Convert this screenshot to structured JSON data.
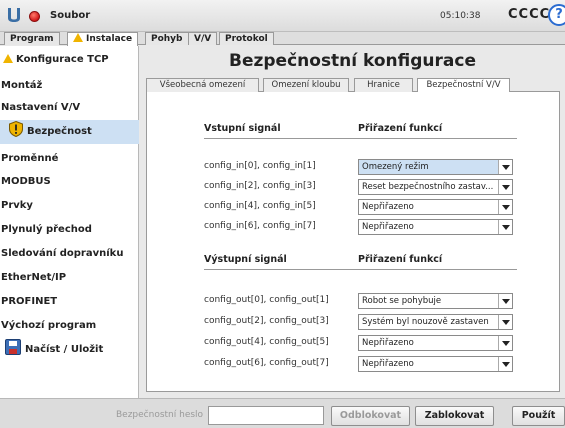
{
  "titlebar": {
    "app_menu": "Soubor",
    "clock": "05:10:38",
    "robot_name": "CCCC",
    "help_icon": "help-icon"
  },
  "main_tabs": [
    "Program",
    "Instalace",
    "Pohyb",
    "V/V",
    "Protokol"
  ],
  "sidebar": {
    "items": [
      "Konfigurace TCP",
      "Montáž",
      "Nastavení V/V",
      "Bezpečnost",
      "Proměnné",
      "MODBUS",
      "Prvky",
      "Plynulý přechod",
      "Sledování dopravníku",
      "EtherNet/IP",
      "PROFINET",
      "Výchozí program",
      "Načíst / Uložit"
    ],
    "selected": "Bezpečnost"
  },
  "content": {
    "title": "Bezpečnostní konfigurace",
    "subtabs": [
      "Všeobecná omezení",
      "Omezení kloubu",
      "Hranice",
      "Bezpečnostní V/V"
    ],
    "active_subtab": "Bezpečnostní V/V",
    "inputs": {
      "header_signal": "Vstupní signál",
      "header_function": "Přiřazení funkcí",
      "rows": [
        {
          "signal": "config_in[0], config_in[1]",
          "function": "Omezený režim"
        },
        {
          "signal": "config_in[2], config_in[3]",
          "function": "Reset bezpečnostního zastav..."
        },
        {
          "signal": "config_in[4], config_in[5]",
          "function": "Nepřiřazeno"
        },
        {
          "signal": "config_in[6], config_in[7]",
          "function": "Nepřiřazeno"
        }
      ]
    },
    "outputs": {
      "header_signal": "Výstupní signál",
      "header_function": "Přiřazení funkcí",
      "rows": [
        {
          "signal": "config_out[0], config_out[1]",
          "function": "Robot se pohybuje"
        },
        {
          "signal": "config_out[2], config_out[3]",
          "function": "Systém byl nouzově zastaven"
        },
        {
          "signal": "config_out[4], config_out[5]",
          "function": "Nepřiřazeno"
        },
        {
          "signal": "config_out[6], config_out[7]",
          "function": "Nepřiřazeno"
        }
      ]
    }
  },
  "bottom": {
    "password_label": "Bezpečnostní heslo",
    "password_value": "",
    "unlock_label": "Odblokovat",
    "lock_label": "Zablokovat",
    "apply_label": "Použít"
  },
  "colors": {
    "selection": "#cde0f3",
    "warning": "#f0b400",
    "record": "#d2191a",
    "help": "#2b6cd1"
  }
}
